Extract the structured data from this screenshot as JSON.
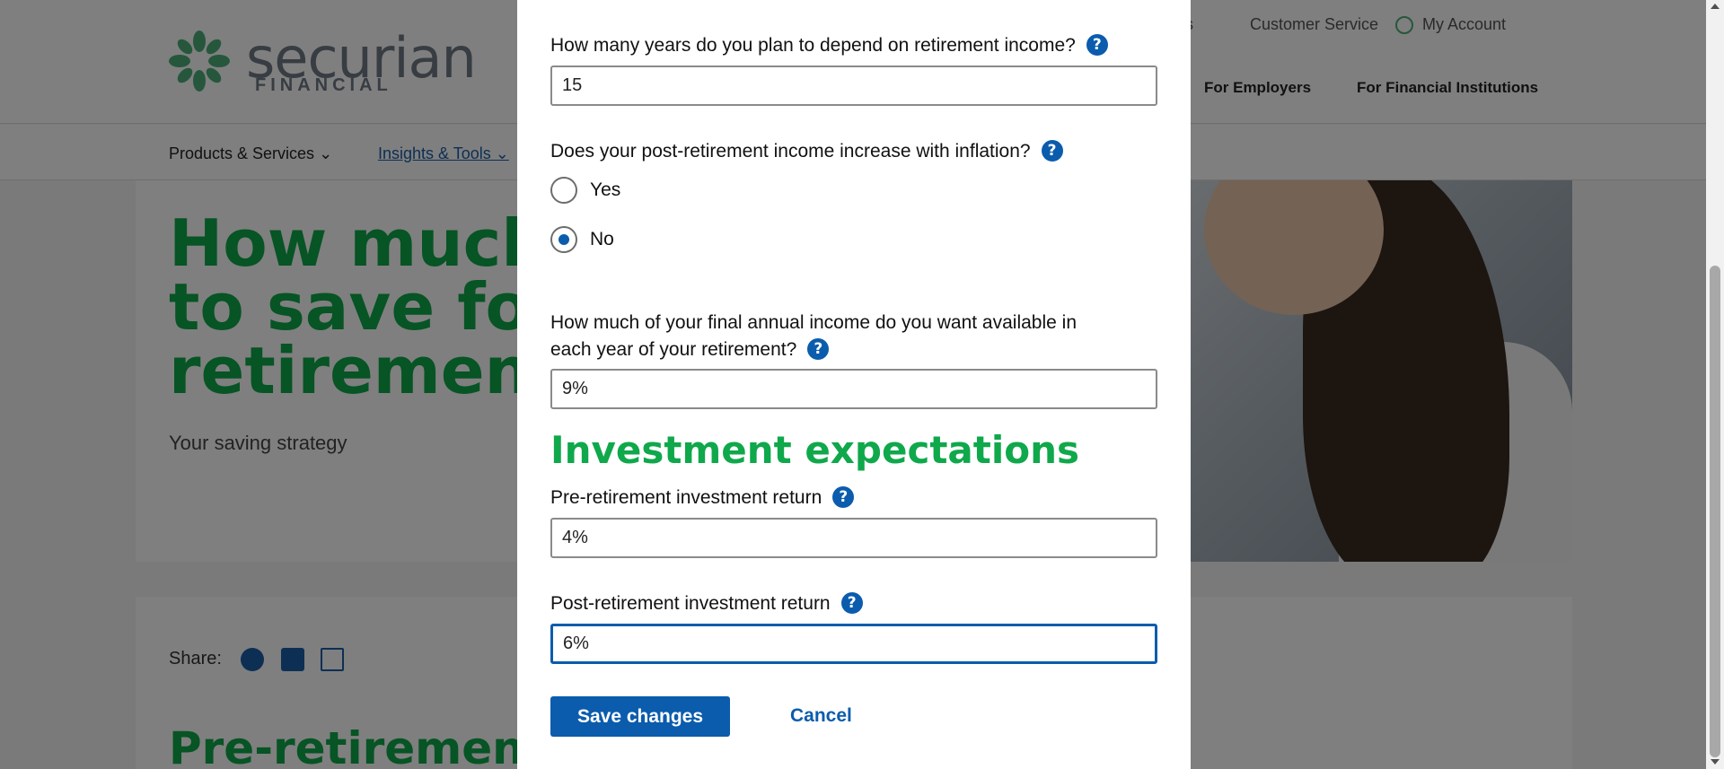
{
  "background": {
    "logo": {
      "word": "securian",
      "sub": "FINANCIAL"
    },
    "utility_nav": {
      "partial_item": "ns",
      "customer_service": "Customer Service",
      "my_account": "My Account"
    },
    "audience_nav": {
      "employers": "For Employers",
      "institutions": "For Financial Institutions"
    },
    "subnav": {
      "products": "Products & Services ⌄",
      "insights": "Insights & Tools ⌄"
    },
    "hero": {
      "title": "How much to save for retirement",
      "subtitle": "Your saving strategy"
    },
    "share": {
      "label": "Share:"
    },
    "card_title": "Pre-retirement cal"
  },
  "modal": {
    "q_years": "How many years do you plan to depend on retirement income?",
    "years_value": "15",
    "q_inflation": "Does your post-retirement income increase with inflation?",
    "inflation_options": [
      {
        "label": "Yes",
        "checked": false
      },
      {
        "label": "No",
        "checked": true
      }
    ],
    "q_income_line1": "How much of your final annual income do you want available in",
    "q_income_line2": "each year of your retirement?",
    "income_value": "9%",
    "section_investment": "Investment expectations",
    "q_pre_return": "Pre-retirement investment return",
    "pre_return_value": "4%",
    "q_post_return": "Post-retirement investment return",
    "post_return_value": "6%",
    "help_glyph": "?",
    "save_label": "Save changes",
    "cancel_label": "Cancel"
  },
  "colors": {
    "accent_blue": "#0b5cad",
    "brand_green": "#0fa84b",
    "overlay": "rgba(0,0,0,0.5)"
  }
}
